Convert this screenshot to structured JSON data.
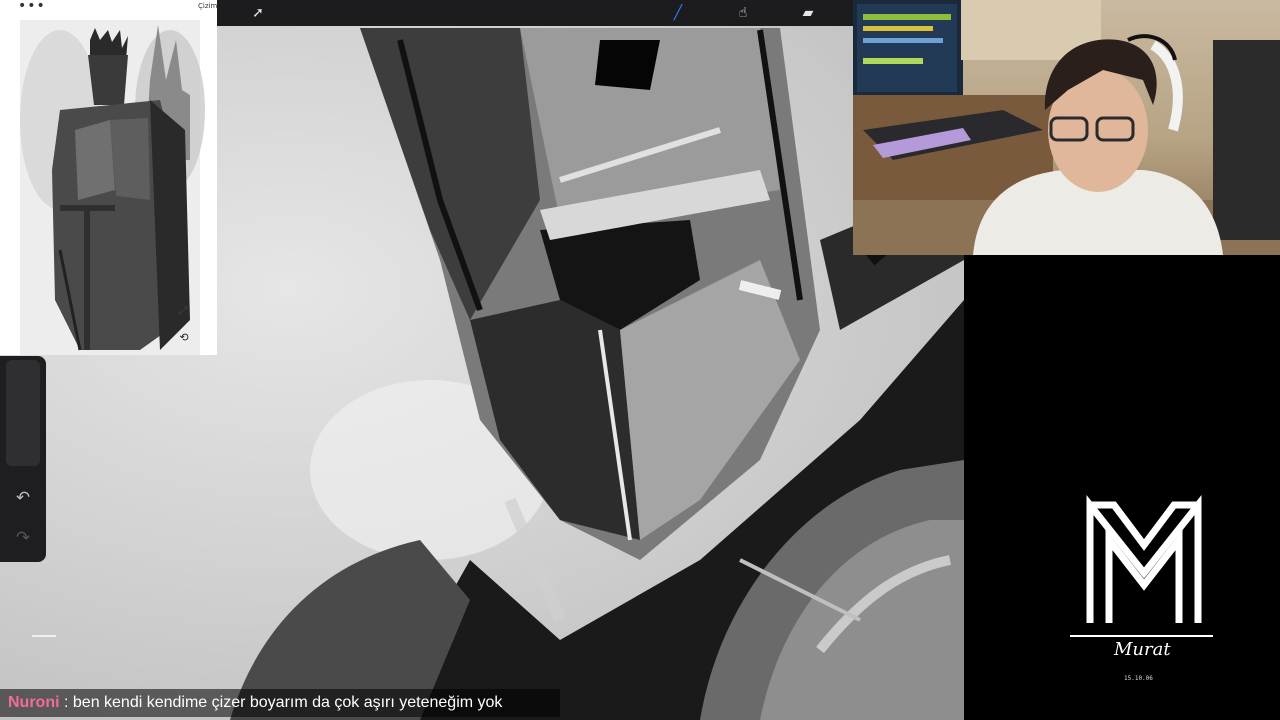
{
  "toolbar": {
    "tools": [
      {
        "name": "selection-arrow-icon",
        "glyph": "➚"
      },
      {
        "name": "brush-icon",
        "glyph": "╱",
        "color": "#2a7fff"
      },
      {
        "name": "smudge-icon",
        "glyph": "☝"
      },
      {
        "name": "eraser-icon",
        "glyph": "▰"
      }
    ]
  },
  "reference": {
    "menu_dots": "•••",
    "label": "Çizim",
    "expand_icon": "⤢",
    "zoom_icon": "⟲"
  },
  "sidebar": {
    "undo_icon": "↶",
    "redo_icon": "↷"
  },
  "logo": {
    "signature": "Murat",
    "date": "15.10.06"
  },
  "chat": {
    "username": "Nuroni",
    "separator": " : ",
    "message": "ben kendi kendime çizer boyarım da çok aşırı yeteneğim yok",
    "username_color": "#f26b9a"
  }
}
